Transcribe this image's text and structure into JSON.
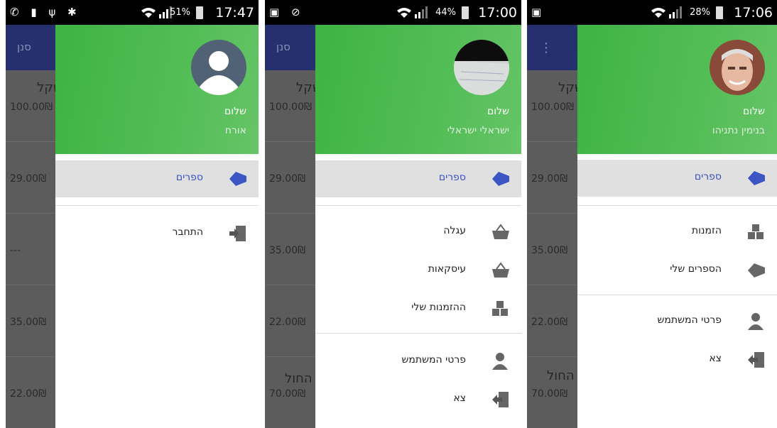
{
  "screens": [
    {
      "status": {
        "time": "17:47",
        "battery": "51%",
        "left_icons": "✆ ▮ ψ ✱"
      },
      "appbar_tab": "סנן",
      "content_title": "שקל",
      "prices": [
        "100.00₪",
        "29.00₪",
        "---",
        "35.00₪",
        "22.00₪"
      ],
      "greeting": "שלום",
      "user": "אורח",
      "primary": [
        {
          "label": "ספרים",
          "icon": "tag-icon"
        }
      ],
      "secondary": [
        {
          "label": "התחבר",
          "icon": "login-icon"
        }
      ]
    },
    {
      "status": {
        "time": "17:00",
        "battery": "44%",
        "left_icons": "▣ ⊘"
      },
      "appbar_tab": "סנן",
      "content_title": "שקל",
      "content_title2": "החול",
      "prices": [
        "100.00₪",
        "29.00₪",
        "35.00₪",
        "22.00₪",
        "70.00₪"
      ],
      "greeting": "שלום",
      "user": "ישראלי ישראלי",
      "primary": [
        {
          "label": "ספרים",
          "icon": "tag-icon"
        }
      ],
      "secondary": [
        {
          "label": "עגלה",
          "icon": "basket-icon"
        },
        {
          "label": "עיסקאות",
          "icon": "basket-icon"
        },
        {
          "label": "ההזמנות שלי",
          "icon": "boxes-icon"
        }
      ],
      "tertiary": [
        {
          "label": "פרטי המשתמש",
          "icon": "user-icon"
        },
        {
          "label": "צא",
          "icon": "logout-icon"
        }
      ]
    },
    {
      "status": {
        "time": "17:06",
        "battery": "28%",
        "left_icons": "▣"
      },
      "appbar_tab": "⋮",
      "content_title": "שקל",
      "content_title2": "החול",
      "prices": [
        "100.00₪",
        "29.00₪",
        "35.00₪",
        "22.00₪",
        "70.00₪"
      ],
      "greeting": "שלום",
      "user": "בנימין נתניהו",
      "primary": [
        {
          "label": "ספרים",
          "icon": "tag-icon"
        }
      ],
      "secondary": [
        {
          "label": "הזמנות",
          "icon": "boxes-icon"
        },
        {
          "label": "הספרים שלי",
          "icon": "tag-icon"
        }
      ],
      "tertiary": [
        {
          "label": "פרטי המשתמש",
          "icon": "user-icon"
        },
        {
          "label": "צא",
          "icon": "logout-icon"
        }
      ]
    }
  ]
}
